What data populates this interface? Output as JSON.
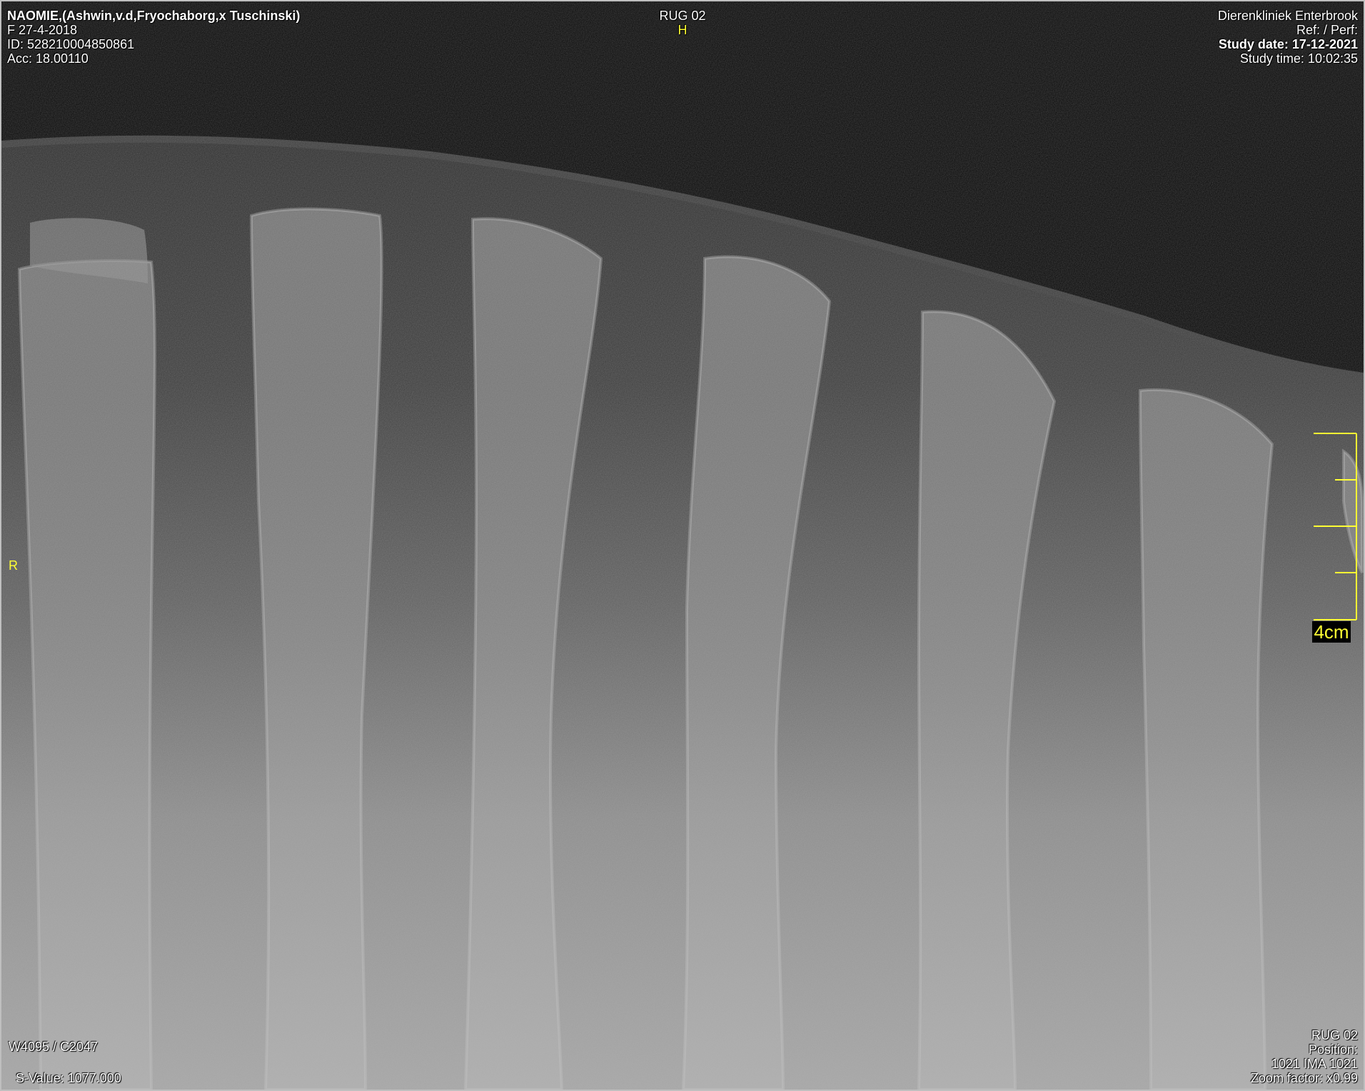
{
  "patient": {
    "name_line": "NAOMIE,(Ashwin,v.d,Fryochaborg,x Tuschinski)",
    "sex_dob": "F  27-4-2018",
    "id": "ID: 528210004850861",
    "acc": "Acc: 18.00110"
  },
  "series": {
    "name": "RUG 02",
    "orientation_top": "H",
    "orientation_left": "R"
  },
  "institution": {
    "name": "Dierenkliniek Enterbrook",
    "ref": "Ref:  / Perf:",
    "study_date": "Study date: 17-12-2021",
    "study_time": "Study time: 10:02:35"
  },
  "window": {
    "wc": "W4095 / C2047",
    "svalue": "S-Value: 1077.000"
  },
  "image_info": {
    "series": "RUG 02",
    "position": "Position:",
    "ima": "1021 IMA 1021",
    "zoom": "Zoom factor: x0.99"
  },
  "scale": {
    "label": "4cm"
  },
  "colors": {
    "overlay_text": "#ffffff",
    "annotation": "#ffff33",
    "frame": "#bfbfbf"
  }
}
